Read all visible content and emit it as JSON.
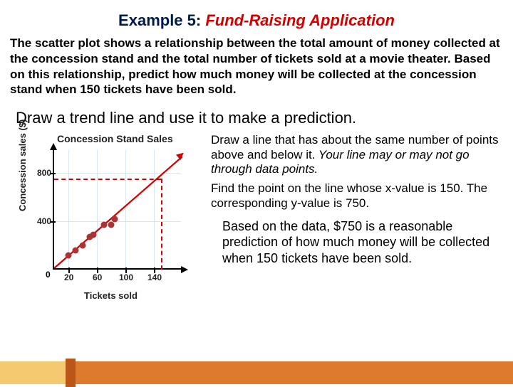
{
  "header": {
    "label": "Example 5: ",
    "title": "Fund-Raising Application"
  },
  "problem": "The scatter plot shows a relationship between the total amount of money collected at the concession stand and the total number of tickets sold at a movie theater. Based on this relationship, predict how much money will be collected at the concession stand when 150 tickets have been sold.",
  "instruction": "Draw a trend line and use it to make a prediction.",
  "steps": {
    "s1a": "Draw a line that has about the same number of points above and below it.",
    "s1b": " Your line may or may not go through data points.",
    "s2": "Find the point on the line whose x-value is 150. The corresponding y-value is 750."
  },
  "conclusion": "Based on the data, $750 is a reasonable prediction of how much money will be collected when 150 tickets have been sold.",
  "chart_data": {
    "type": "scatter",
    "title": "Concession Stand Sales",
    "xlabel": "Tickets sold",
    "ylabel": "Concession sales ($)",
    "x_ticks": [
      20,
      60,
      100,
      140
    ],
    "y_ticks": [
      400,
      800
    ],
    "xlim": [
      0,
      180
    ],
    "ylim": [
      0,
      1000
    ],
    "origin": "0",
    "points": [
      {
        "x": 20,
        "y": 120
      },
      {
        "x": 30,
        "y": 160
      },
      {
        "x": 40,
        "y": 200
      },
      {
        "x": 50,
        "y": 270
      },
      {
        "x": 55,
        "y": 290
      },
      {
        "x": 70,
        "y": 370
      },
      {
        "x": 80,
        "y": 370
      },
      {
        "x": 85,
        "y": 420
      }
    ],
    "trend_line": {
      "x1": 0,
      "y1": 0,
      "x2": 180,
      "y2": 920
    },
    "prediction": {
      "x": 150,
      "y": 750
    }
  }
}
